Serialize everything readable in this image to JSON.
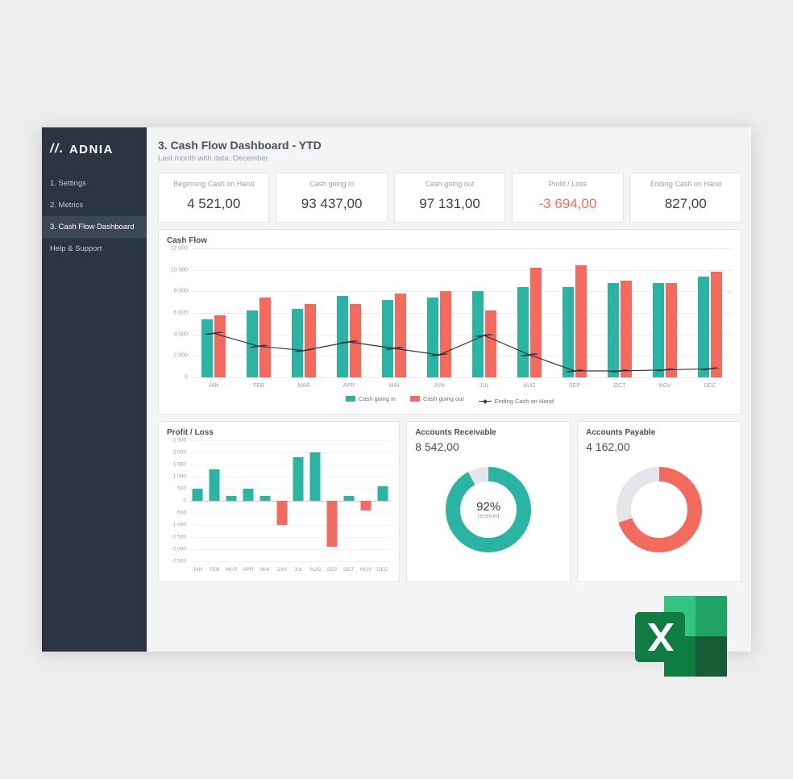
{
  "brand": "ADNIA",
  "sidebar": {
    "items": [
      {
        "label": "1. Settings"
      },
      {
        "label": "2. Metrics"
      },
      {
        "label": "3. Cash Flow Dashboard"
      },
      {
        "label": "Help & Support"
      }
    ],
    "active_index": 2
  },
  "header": {
    "title": "3. Cash Flow Dashboard - YTD",
    "subtitle_prefix": "Last month with data:",
    "subtitle_value": "December"
  },
  "kpis": [
    {
      "label": "Beginning Cash on Hand",
      "value": "4 521,00"
    },
    {
      "label": "Cash going in",
      "value": "93 437,00"
    },
    {
      "label": "Cash going out",
      "value": "97 131,00"
    },
    {
      "label": "Profit / Loss",
      "value": "-3 694,00",
      "negative": true
    },
    {
      "label": "Ending Cash on Hand",
      "value": "827,00"
    }
  ],
  "cashflow": {
    "title": "Cash Flow",
    "legend": {
      "in": "Cash going in",
      "out": "Cash going out",
      "end": "Ending Cash on Hand"
    }
  },
  "profit_loss": {
    "title": "Profit / Loss"
  },
  "receivable": {
    "title": "Accounts Receivable",
    "value": "8 542,00",
    "pct_label": "92%",
    "sub": "received"
  },
  "payable": {
    "title": "Accounts Payable",
    "value": "4 162,00"
  },
  "chart_data": [
    {
      "id": "cashflow",
      "type": "bar+line",
      "categories": [
        "JAN",
        "FEB",
        "MAR",
        "APR",
        "MAI",
        "JUN",
        "JUL",
        "AUG",
        "SEP",
        "OCT",
        "NOV",
        "DEC"
      ],
      "series": [
        {
          "name": "Cash going in",
          "type": "bar",
          "color": "#2bb3a3",
          "values": [
            5400,
            6200,
            6400,
            7600,
            7200,
            7400,
            8000,
            8400,
            8400,
            8800,
            8800,
            9400
          ]
        },
        {
          "name": "Cash going out",
          "type": "bar",
          "color": "#f26b5e",
          "values": [
            5800,
            7400,
            6800,
            6800,
            7800,
            8000,
            6200,
            10200,
            10400,
            9000,
            8800,
            9800
          ]
        },
        {
          "name": "Ending Cash on Hand",
          "type": "line",
          "color": "#2e3740",
          "values": [
            4100,
            2900,
            2500,
            3300,
            2700,
            2100,
            3900,
            2100,
            600,
            600,
            700,
            800
          ]
        }
      ],
      "ylim": [
        0,
        12000
      ],
      "yticks": [
        0,
        2000,
        4000,
        6000,
        8000,
        10000,
        12000
      ],
      "ytick_labels": [
        "0",
        "2 000",
        "4 000",
        "6 000",
        "8 000",
        "10 000",
        "12 000"
      ]
    },
    {
      "id": "profit_loss",
      "type": "bar",
      "categories": [
        "JAN",
        "FEB",
        "MAR",
        "APR",
        "MAI",
        "JUN",
        "JUL",
        "AUG",
        "SEP",
        "OCT",
        "NOV",
        "DEC"
      ],
      "values": [
        500,
        1300,
        200,
        500,
        200,
        -1000,
        1800,
        2000,
        -1900,
        200,
        -400,
        600
      ],
      "ylim": [
        -2500,
        2500
      ],
      "yticks": [
        -2500,
        -2000,
        -1500,
        -1000,
        -500,
        0,
        500,
        1000,
        1500,
        2000,
        2500
      ],
      "ytick_labels": [
        "-2 500",
        "-2 000",
        "-1 500",
        "-1 000",
        "-500",
        "0",
        "500",
        "1 000",
        "1 500",
        "2 000",
        "2 500"
      ],
      "colors": {
        "pos": "#2bb3a3",
        "neg": "#f26b5e"
      }
    },
    {
      "id": "receivable",
      "type": "donut",
      "value": 92,
      "max": 100,
      "color": "#2bb3a3",
      "track": "#e4e6ea",
      "center_label": "92%",
      "center_sub": "received"
    },
    {
      "id": "payable",
      "type": "donut",
      "value": 70,
      "max": 100,
      "color": "#f26b5e",
      "track": "#e4e6ea"
    }
  ]
}
